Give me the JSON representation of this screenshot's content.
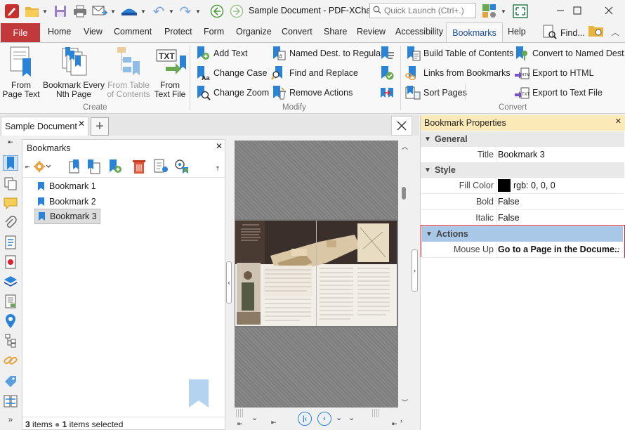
{
  "title_bar": {
    "document_title": "Sample Document - PDF-XCha...",
    "quick_launch_placeholder": "Quick Launch (Ctrl+.)"
  },
  "menu_tabs": {
    "file": "File",
    "items": [
      "Home",
      "View",
      "Comment",
      "Protect",
      "Form",
      "Organize",
      "Convert",
      "Share",
      "Review",
      "Accessibility"
    ],
    "active": "Bookmarks",
    "help": "Help",
    "find": "Find..."
  },
  "ribbon": {
    "create": {
      "label": "Create",
      "from_page_text": [
        "From",
        "Page Text"
      ],
      "bookmark_every": [
        "Bookmark Every",
        "Nth Page"
      ],
      "from_table": [
        "From Table",
        "of Contents"
      ],
      "from_text_file": [
        "From",
        "Text File"
      ]
    },
    "modify": {
      "label": "Modify",
      "add_text": "Add Text",
      "change_case": "Change Case",
      "change_zoom": "Change Zoom",
      "named_dest": "Named Dest. to Regular",
      "find_replace": "Find and Replace",
      "remove_actions": "Remove Actions"
    },
    "convert": {
      "label": "Convert",
      "build_toc": "Build Table of Contents",
      "links_from_bookmarks": "Links from Bookmarks",
      "sort_pages": "Sort Pages",
      "convert_named": "Convert to Named Dest.",
      "export_html": "Export to HTML",
      "export_text": "Export to Text File"
    }
  },
  "document_tab": {
    "name": "Sample Document"
  },
  "bookmarks_panel": {
    "title": "Bookmarks",
    "items": [
      "Bookmark 1",
      "Bookmark 2",
      "Bookmark 3"
    ],
    "selected_index": 2,
    "status_count": "3",
    "status_items": "items",
    "status_selected_count": "1",
    "status_selected": "items selected"
  },
  "properties": {
    "title": "Bookmark Properties",
    "general": {
      "label": "General",
      "title_key": "Title",
      "title_value": "Bookmark 3"
    },
    "style": {
      "label": "Style",
      "fill_key": "Fill Color",
      "fill_value": "rgb: 0, 0, 0",
      "bold_key": "Bold",
      "bold_value": "False",
      "italic_key": "Italic",
      "italic_value": "False"
    },
    "actions": {
      "label": "Actions",
      "mouse_key": "Mouse Up",
      "mouse_value": "Go to a Page in the Docume..",
      "more": "···"
    }
  },
  "colors": {
    "accent": "#1c4fa0",
    "file_tab": "#c1393a",
    "bookmark_blue": "#2a83d6",
    "selected_highlight": "#d9232f",
    "panel_header": "#fbe9b7"
  }
}
